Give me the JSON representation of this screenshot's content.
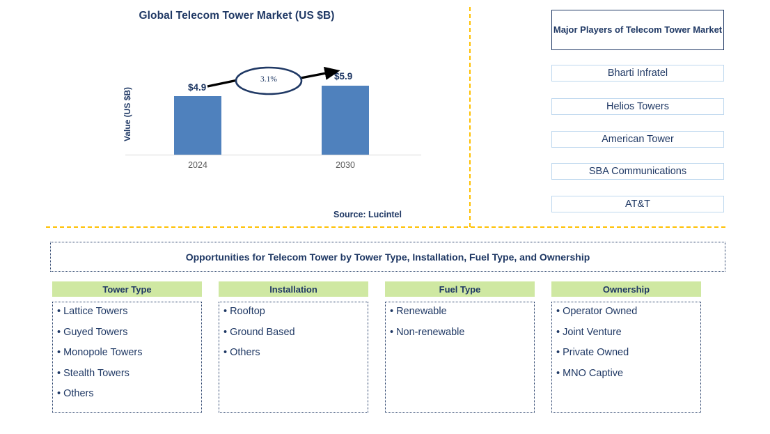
{
  "chart": {
    "title": "Global Telecom Tower Market (US $B)",
    "y_axis_label": "Value (US $B)",
    "cagr_label": "3.1%",
    "source": "Source: Lucintel"
  },
  "chart_data": {
    "type": "bar",
    "title": "Global Telecom Tower Market (US $B)",
    "categories": [
      "2024",
      "2030"
    ],
    "values": [
      4.9,
      5.9
    ],
    "value_labels": [
      "$4.9",
      "$5.9"
    ],
    "xlabel": "",
    "ylabel": "Value (US $B)",
    "ylim": [
      0,
      7
    ],
    "grid": false,
    "legend": "none",
    "annotations": [
      {
        "text": "3.1%",
        "type": "cagr-arrow",
        "from": "2024",
        "to": "2030"
      }
    ],
    "series": [
      {
        "name": "Value (US $B)",
        "values": [
          4.9,
          5.9
        ],
        "color": "#4F81BD"
      }
    ],
    "source": "Source: Lucintel"
  },
  "players": {
    "header": "Major Players of Telecom Tower Market",
    "items": [
      "Bharti Infratel",
      "Helios Towers",
      "American Tower",
      "SBA Communications",
      "AT&T"
    ]
  },
  "opportunities": {
    "banner": "Opportunities for Telecom Tower by Tower Type, Installation, Fuel Type, and Ownership",
    "columns": [
      {
        "header": "Tower Type",
        "items": [
          "Lattice Towers",
          "Guyed Towers",
          "Monopole Towers",
          "Stealth Towers",
          "Others"
        ]
      },
      {
        "header": "Installation",
        "items": [
          "Rooftop",
          "Ground Based",
          "Others"
        ]
      },
      {
        "header": "Fuel Type",
        "items": [
          "Renewable",
          "Non-renewable"
        ]
      },
      {
        "header": "Ownership",
        "items": [
          "Operator Owned",
          "Joint Venture",
          "Private Owned",
          "MNO Captive"
        ]
      }
    ]
  },
  "colors": {
    "bar": "#4F81BD",
    "text_navy": "#1F3864",
    "divider_orange": "#FFC000",
    "category_header_green": "#CFE8A2",
    "player_border": "#BDD7EE"
  }
}
